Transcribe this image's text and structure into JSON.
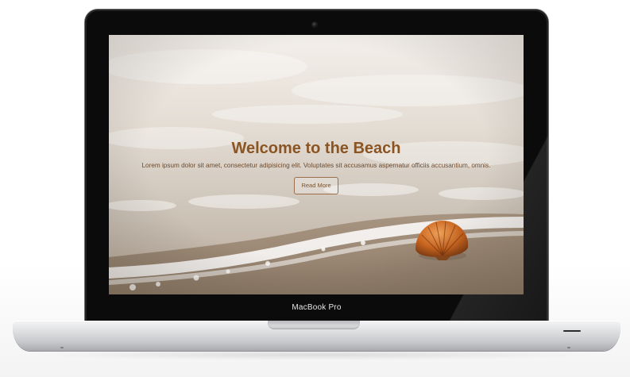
{
  "device": {
    "brand_label": "MacBook Pro"
  },
  "website": {
    "hero": {
      "title": "Welcome to the Beach",
      "text": "Lorem ipsum dolor sit amet, consectetur adipisicing elit. Voluptates sit accusamus aspernatur officiis accusantium, omnis.",
      "button_label": "Read More"
    },
    "background_image": "beach-sand-wave-seashell"
  },
  "colors": {
    "title": "#8a5522",
    "button_border": "#9b6f49",
    "bezel": "#0b0b0b",
    "aluminum": "#d6d7d9"
  }
}
